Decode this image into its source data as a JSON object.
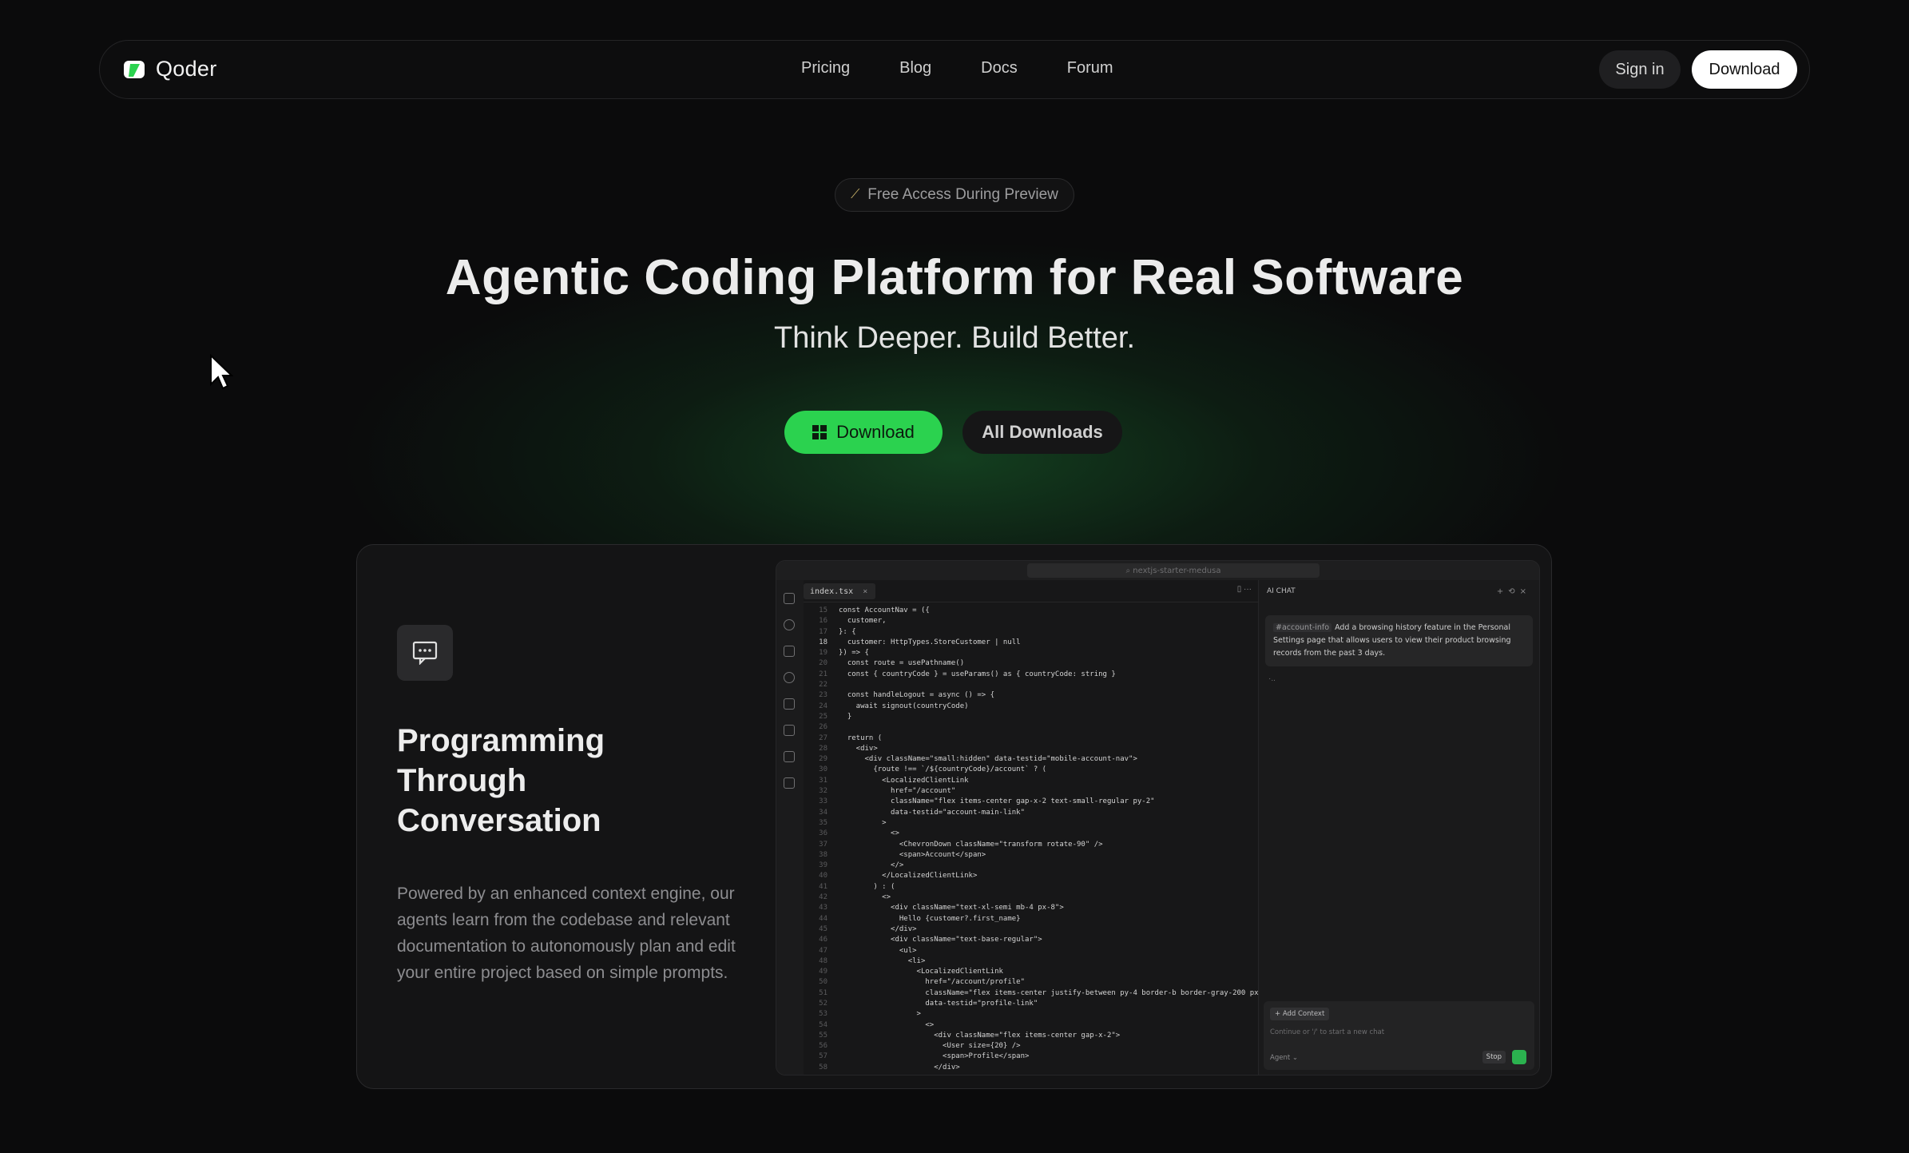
{
  "nav": {
    "logo_text": "Qoder",
    "links": [
      "Pricing",
      "Blog",
      "Docs",
      "Forum"
    ],
    "signin": "Sign in",
    "download": "Download"
  },
  "hero": {
    "badge": "Free Access During Preview",
    "title": "Agentic Coding Platform for Real Software",
    "subtitle": "Think Deeper. Build Better.",
    "primary_button": "Download",
    "secondary_button": "All Downloads"
  },
  "feature": {
    "title": "Programming Through Conversation",
    "description": "Powered by an enhanced context engine, our agents learn from the codebase and relevant documentation to autonomously plan and edit your entire project based on simple prompts."
  },
  "ide": {
    "search": "nextjs-starter-medusa",
    "tab": "index.tsx",
    "chat_title": "AI CHAT",
    "chat_ref": "#account-info",
    "chat_message": "Add a browsing history feature in the Personal Settings page that allows users to view their product browsing records from the past 3 days.",
    "chat_dots": "·..",
    "add_context": "+ Add Context",
    "input_placeholder": "Continue or '/' to start a new chat",
    "agent": "Agent ⌄",
    "stop": "Stop",
    "code_lines": [
      {
        "n": "15",
        "c": "const AccountNav = ({"
      },
      {
        "n": "16",
        "c": "  customer,"
      },
      {
        "n": "17",
        "c": "}: {"
      },
      {
        "n": "18",
        "c": "  customer: HttpTypes.StoreCustomer | null"
      },
      {
        "n": "19",
        "c": "}) => {"
      },
      {
        "n": "20",
        "c": "  const route = usePathname()"
      },
      {
        "n": "21",
        "c": "  const { countryCode } = useParams() as { countryCode: string }"
      },
      {
        "n": "22",
        "c": ""
      },
      {
        "n": "23",
        "c": "  const handleLogout = async () => {"
      },
      {
        "n": "24",
        "c": "    await signout(countryCode)"
      },
      {
        "n": "25",
        "c": "  }"
      },
      {
        "n": "26",
        "c": ""
      },
      {
        "n": "27",
        "c": "  return ("
      },
      {
        "n": "28",
        "c": "    <div>"
      },
      {
        "n": "29",
        "c": "      <div className=\"small:hidden\" data-testid=\"mobile-account-nav\">"
      },
      {
        "n": "30",
        "c": "        {route !== `/${countryCode}/account` ? ("
      },
      {
        "n": "31",
        "c": "          <LocalizedClientLink"
      },
      {
        "n": "32",
        "c": "            href=\"/account\""
      },
      {
        "n": "33",
        "c": "            className=\"flex items-center gap-x-2 text-small-regular py-2\""
      },
      {
        "n": "34",
        "c": "            data-testid=\"account-main-link\""
      },
      {
        "n": "35",
        "c": "          >"
      },
      {
        "n": "36",
        "c": "            <>"
      },
      {
        "n": "37",
        "c": "              <ChevronDown className=\"transform rotate-90\" />"
      },
      {
        "n": "38",
        "c": "              <span>Account</span>"
      },
      {
        "n": "39",
        "c": "            </>"
      },
      {
        "n": "40",
        "c": "          </LocalizedClientLink>"
      },
      {
        "n": "41",
        "c": "        ) : ("
      },
      {
        "n": "42",
        "c": "          <>"
      },
      {
        "n": "43",
        "c": "            <div className=\"text-xl-semi mb-4 px-8\">"
      },
      {
        "n": "44",
        "c": "              Hello {customer?.first_name}"
      },
      {
        "n": "45",
        "c": "            </div>"
      },
      {
        "n": "46",
        "c": "            <div className=\"text-base-regular\">"
      },
      {
        "n": "47",
        "c": "              <ul>"
      },
      {
        "n": "48",
        "c": "                <li>"
      },
      {
        "n": "49",
        "c": "                  <LocalizedClientLink"
      },
      {
        "n": "50",
        "c": "                    href=\"/account/profile\""
      },
      {
        "n": "51",
        "c": "                    className=\"flex items-center justify-between py-4 border-b border-gray-200 px-"
      },
      {
        "n": "52",
        "c": "                    data-testid=\"profile-link\""
      },
      {
        "n": "53",
        "c": "                  >"
      },
      {
        "n": "54",
        "c": "                    <>"
      },
      {
        "n": "55",
        "c": "                      <div className=\"flex items-center gap-x-2\">"
      },
      {
        "n": "56",
        "c": "                        <User size={20} />"
      },
      {
        "n": "57",
        "c": "                        <span>Profile</span>"
      },
      {
        "n": "58",
        "c": "                      </div>"
      }
    ]
  },
  "colors": {
    "accent_green": "#2bd24f",
    "background": "#0b0b0c",
    "card": "#141415"
  },
  "icons": [
    "qoder-logo-icon",
    "wand-icon",
    "windows-icon",
    "chat-bubble-icon",
    "mouse-cursor-icon"
  ]
}
